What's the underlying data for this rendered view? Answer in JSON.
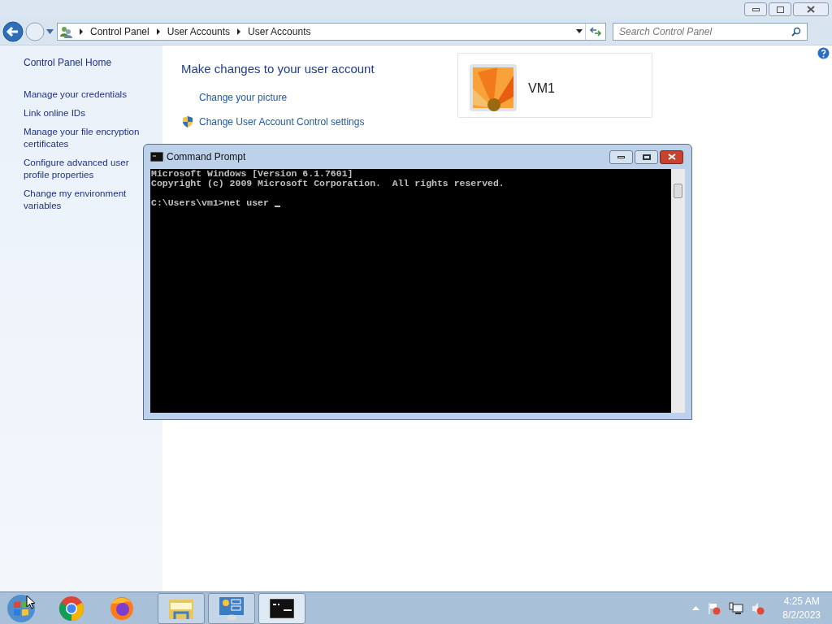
{
  "window": {
    "breadcrumb": [
      "Control Panel",
      "User Accounts",
      "User Accounts"
    ],
    "search": {
      "placeholder": "Search Control Panel"
    }
  },
  "sidebar": {
    "home": "Control Panel Home",
    "items": [
      "Manage your credentials",
      "Link online IDs",
      "Manage your file encryption certificates",
      "Configure advanced user profile properties",
      "Change my environment variables"
    ]
  },
  "content": {
    "heading": "Make changes to your user account",
    "links": [
      {
        "label": "Change your picture",
        "kind": "plain"
      },
      {
        "label": "Change User Account Control settings",
        "kind": "shield"
      }
    ],
    "account": {
      "name": "VM1"
    }
  },
  "console": {
    "title": "Command Prompt",
    "lines": [
      "Microsoft Windows [Version 6.1.7601]",
      "Copyright (c) 2009 Microsoft Corporation.  All rights reserved."
    ],
    "prompt": "C:\\Users\\vm1>net user "
  },
  "taskbar": {
    "time": "4:25 AM",
    "date": "8/2/2023"
  }
}
